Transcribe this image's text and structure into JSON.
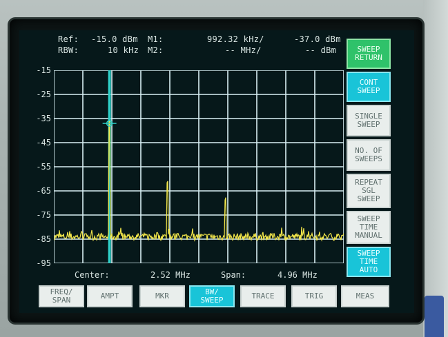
{
  "header": {
    "ref_label": "Ref:",
    "ref_value": "-15.0 dBm",
    "m1_label": "M1:",
    "m1_freq": "992.32 kHz/",
    "m1_level": "-37.0 dBm",
    "rbw_label": "RBW:",
    "rbw_value": "10 kHz",
    "m2_label": "M2:",
    "m2_freq": "-- MHz/",
    "m2_level": "-- dBm"
  },
  "y_axis": [
    "-15",
    "-25",
    "-35",
    "-45",
    "-55",
    "-65",
    "-75",
    "-85",
    "-95"
  ],
  "footer": {
    "center_label": "Center:",
    "center_value": "2.52 MHz",
    "span_label": "Span:",
    "span_value": "4.96 MHz"
  },
  "softkeys": [
    {
      "label": "SWEEP\nRETURN",
      "state": "green"
    },
    {
      "label": "CONT\nSWEEP",
      "state": "cyan"
    },
    {
      "label": "SINGLE\nSWEEP",
      "state": "normal"
    },
    {
      "label": "NO. OF\nSWEEPS",
      "state": "normal"
    },
    {
      "label": "REPEAT\nSGL\nSWEEP",
      "state": "normal"
    },
    {
      "label": "SWEEP\nTIME\nMANUAL",
      "state": "normal"
    },
    {
      "label": "SWEEP\nTIME\nAUTO",
      "state": "cyan"
    }
  ],
  "hotkeys": [
    {
      "label": "FREQ/\nSPAN",
      "state": "normal"
    },
    {
      "label": "AMPT",
      "state": "normal"
    },
    {
      "label": "MKR",
      "state": "normal"
    },
    {
      "label": "BW/\nSWEEP",
      "state": "cyan"
    },
    {
      "label": "TRACE",
      "state": "normal"
    },
    {
      "label": "TRIG",
      "state": "normal"
    },
    {
      "label": "MEAS",
      "state": "normal"
    }
  ],
  "colors": {
    "grid": "#d8f0f4",
    "trace": "#f2e64a",
    "marker_line": "#2fd0c8",
    "green": "#2fc26a",
    "cyan": "#19c4d8"
  },
  "chart_data": {
    "type": "line",
    "x_range_mhz": [
      0.04,
      5.0
    ],
    "ylim": [
      -95,
      -15
    ],
    "grid": true,
    "noise_floor_dbm": -84,
    "peaks": [
      {
        "x_mhz": 0.99,
        "y_dbm": -37
      },
      {
        "x_mhz": 1.98,
        "y_dbm": -62
      },
      {
        "x_mhz": 2.97,
        "y_dbm": -69
      }
    ],
    "marker": {
      "name": "M1",
      "x_mhz": 0.99232,
      "y_dbm": -37.0
    }
  }
}
